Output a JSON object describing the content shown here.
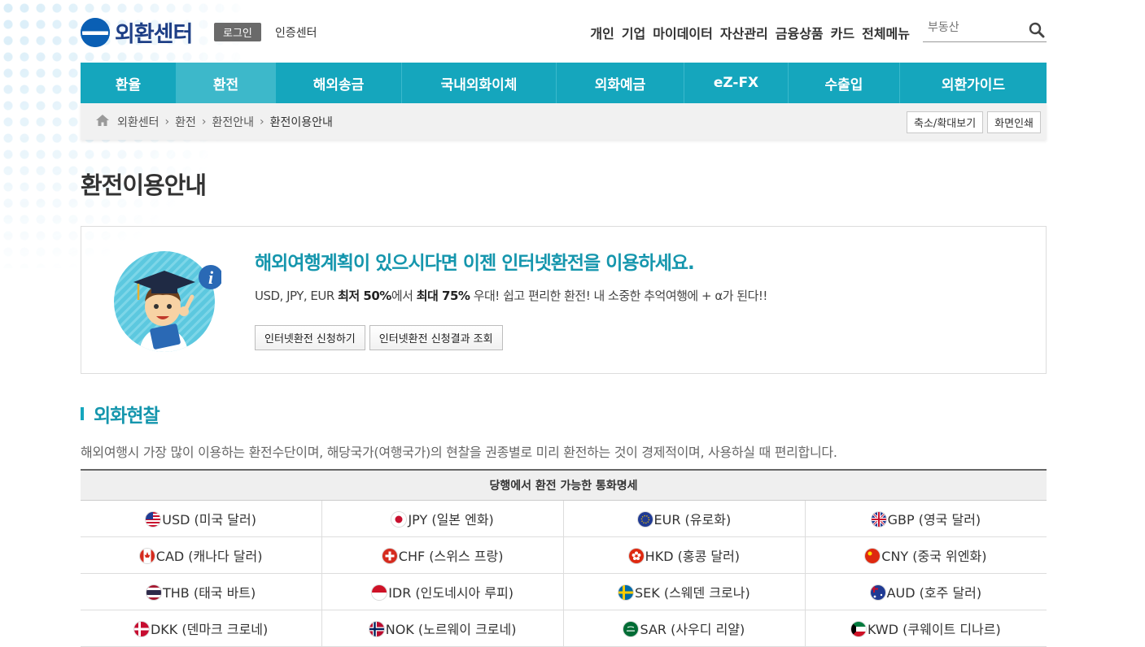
{
  "header": {
    "logo": "외환센터",
    "login": "로그인",
    "cert": "인증센터",
    "nav": [
      "개인",
      "기업",
      "마이데이터",
      "자산관리",
      "금융상품",
      "카드",
      "전체메뉴"
    ],
    "search_placeholder": "부동산"
  },
  "gnb": [
    {
      "label": "환율",
      "active": false
    },
    {
      "label": "환전",
      "active": true
    },
    {
      "label": "해외송금",
      "active": false
    },
    {
      "label": "국내외화이체",
      "active": false
    },
    {
      "label": "외화예금",
      "active": false
    },
    {
      "label": "eZ-FX",
      "active": false
    },
    {
      "label": "수출입",
      "active": false
    },
    {
      "label": "외환가이드",
      "active": false
    }
  ],
  "breadcrumb": {
    "items": [
      "외환센터",
      "환전",
      "환전안내"
    ],
    "current": "환전이용안내",
    "zoom_btn": "축소/확대보기",
    "print_btn": "화면인쇄"
  },
  "page_title": "환전이용안내",
  "info": {
    "heading": "해외여행계획이 있으시다면 이젠 인터넷환전을 이용하세요.",
    "p_prefix": "USD, JPY, EUR ",
    "p_b1": "최저 50%",
    "p_mid": "에서 ",
    "p_b2": "최대 75%",
    "p_suffix": " 우대! 쉽고 편리한 환전! 내 소중한 추억여행에 + α가 된다!!",
    "btn_apply": "인터넷환전 신청하기",
    "btn_result": "인터넷환전 신청결과 조회"
  },
  "section": {
    "title": "외화현찰",
    "desc": "해외여행시 가장 많이 이용하는 환전수단이며, 해당국가(여행국가)의 현찰을 권종별로 미리 환전하는 것이 경제적이며, 사용하실 때 편리합니다.",
    "table_header": "당행에서 환전 가능한 통화명세"
  },
  "currencies": [
    [
      {
        "code": "USD",
        "name": "USD (미국 달러)"
      },
      {
        "code": "JPY",
        "name": "JPY (일본 엔화)"
      },
      {
        "code": "EUR",
        "name": "EUR (유로화)"
      },
      {
        "code": "GBP",
        "name": "GBP (영국 달러)"
      }
    ],
    [
      {
        "code": "CAD",
        "name": "CAD (캐나다 달러)"
      },
      {
        "code": "CHF",
        "name": "CHF (스위스 프랑)"
      },
      {
        "code": "HKD",
        "name": "HKD (홍콩 달러)"
      },
      {
        "code": "CNY",
        "name": "CNY (중국 위엔화)"
      }
    ],
    [
      {
        "code": "THB",
        "name": "THB (태국 바트)"
      },
      {
        "code": "IDR",
        "name": "IDR (인도네시아 루피)"
      },
      {
        "code": "SEK",
        "name": "SEK (스웨덴 크로나)"
      },
      {
        "code": "AUD",
        "name": "AUD (호주 달러)"
      }
    ],
    [
      {
        "code": "DKK",
        "name": "DKK (덴마크 크로네)"
      },
      {
        "code": "NOK",
        "name": "NOK (노르웨이 크로네)"
      },
      {
        "code": "SAR",
        "name": "SAR (사우디 리얄)"
      },
      {
        "code": "KWD",
        "name": "KWD (쿠웨이트 디나르)"
      }
    ]
  ],
  "colors": {
    "accent": "#15a6bd",
    "title_teal": "#1596ad",
    "brand_navy": "#1e3f86"
  }
}
